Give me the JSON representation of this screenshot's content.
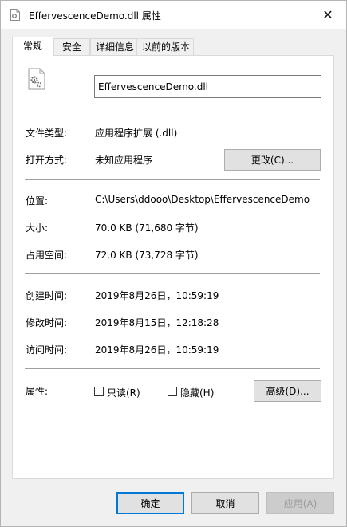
{
  "window": {
    "title": "EffervescenceDemo.dll 属性",
    "close_glyph": "✕"
  },
  "tabs": [
    {
      "label": "常规",
      "active": true
    },
    {
      "label": "安全",
      "active": false
    },
    {
      "label": "详细信息",
      "active": false
    },
    {
      "label": "以前的版本",
      "active": false
    }
  ],
  "general": {
    "file_name": "EffervescenceDemo.dll",
    "file_type_label": "文件类型:",
    "file_type_value": "应用程序扩展 (.dll)",
    "open_with_label": "打开方式:",
    "open_with_value": "未知应用程序",
    "change_button": "更改(C)...",
    "location_label": "位置:",
    "location_value": "C:\\Users\\ddooo\\Desktop\\EffervescenceDemo",
    "size_label": "大小:",
    "size_value": "70.0 KB (71,680 字节)",
    "size_on_disk_label": "占用空间:",
    "size_on_disk_value": "72.0 KB (73,728 字节)",
    "created_label": "创建时间:",
    "created_value": "2019年8月26日，10:59:19",
    "modified_label": "修改时间:",
    "modified_value": "2019年8月15日，12:18:28",
    "accessed_label": "访问时间:",
    "accessed_value": "2019年8月26日，10:59:19",
    "attributes_label": "属性:",
    "readonly_label": "只读(R)",
    "hidden_label": "隐藏(H)",
    "advanced_button": "高级(D)..."
  },
  "footer": {
    "ok": "确定",
    "cancel": "取消",
    "apply": "应用(A)"
  },
  "colors": {
    "accent": "#0078d7",
    "window_bg": "#f0f0f0",
    "panel_bg": "#ffffff"
  }
}
